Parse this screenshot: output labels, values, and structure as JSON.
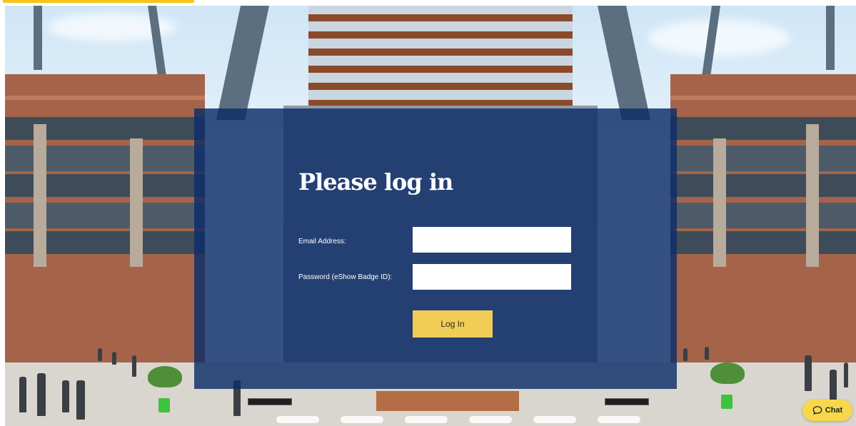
{
  "login": {
    "title": "Please log in",
    "email_label": "Email Address:",
    "email_value": "",
    "password_label": "Password (eShow Badge ID):",
    "password_value": "",
    "submit_label": "Log In"
  },
  "chat": {
    "label": "Chat",
    "icon": "chat-bubble-icon"
  },
  "colors": {
    "panel": "#0c2c68",
    "button": "#f2cd55",
    "chat": "#f7d84c",
    "accent": "#f5c518"
  }
}
